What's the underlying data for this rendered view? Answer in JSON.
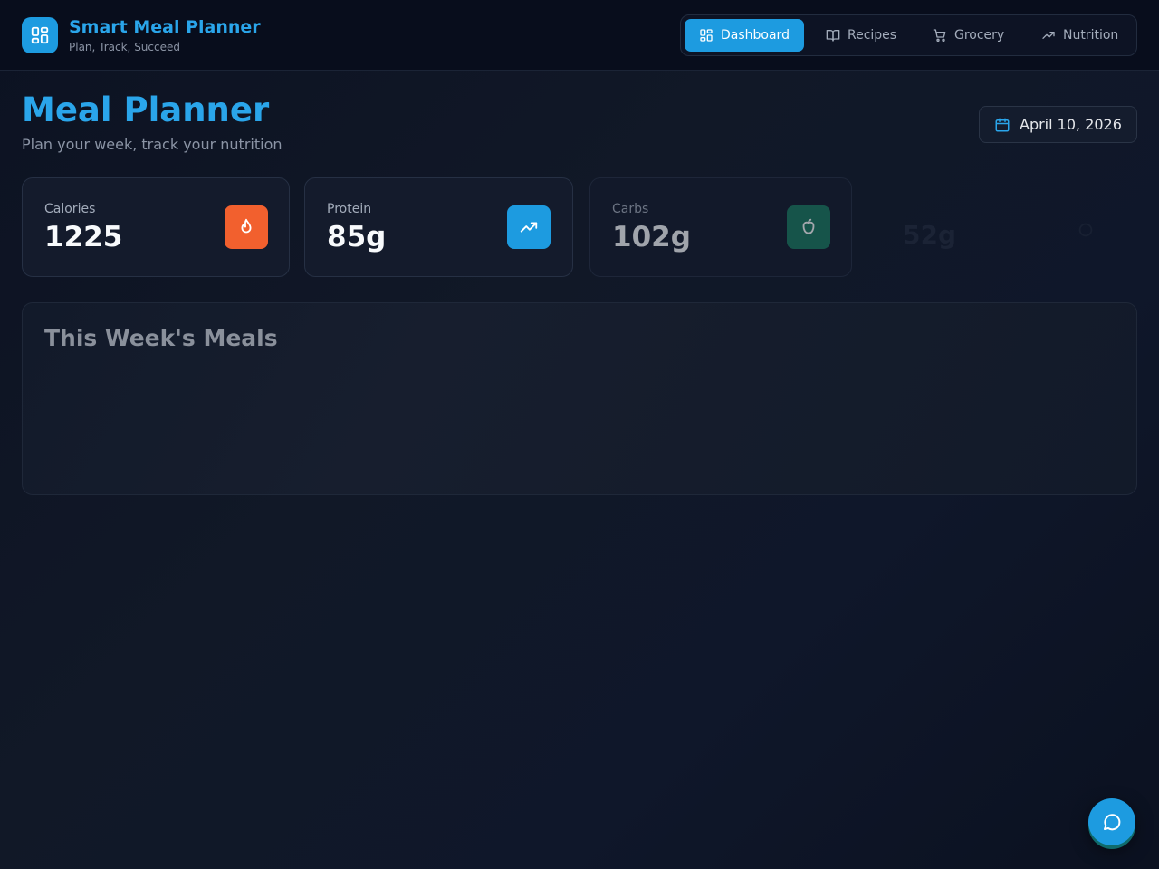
{
  "header": {
    "app_title": "Smart Meal Planner",
    "tagline": "Plan, Track, Succeed",
    "logo_icon": "dashboard-grid-icon"
  },
  "nav": {
    "items": [
      {
        "label": "Dashboard",
        "icon": "dashboard-grid-icon",
        "active": true
      },
      {
        "label": "Recipes",
        "icon": "book-open-icon",
        "active": false
      },
      {
        "label": "Grocery",
        "icon": "shopping-cart-icon",
        "active": false
      },
      {
        "label": "Nutrition",
        "icon": "trending-up-icon",
        "active": false
      }
    ]
  },
  "page": {
    "title": "Meal Planner",
    "subtitle": "Plan your week, track your nutrition",
    "date": "April 10, 2026"
  },
  "stats": [
    {
      "label": "Calories",
      "value": "1225",
      "icon": "flame-icon",
      "color": "#f2602e"
    },
    {
      "label": "Protein",
      "value": "85g",
      "icon": "trending-up-icon",
      "color": "#1d9be0"
    },
    {
      "label": "Carbs",
      "value": "102g",
      "icon": "apple-icon",
      "color": "#1a7a5f"
    },
    {
      "label": "",
      "value": "52g",
      "icon": "",
      "color": ""
    }
  ],
  "meals": {
    "title": "This Week's Meals"
  },
  "colors": {
    "accent": "#1d9be0",
    "background": "#0f172a"
  },
  "chat": {
    "icon": "chat-bubble-icon"
  }
}
